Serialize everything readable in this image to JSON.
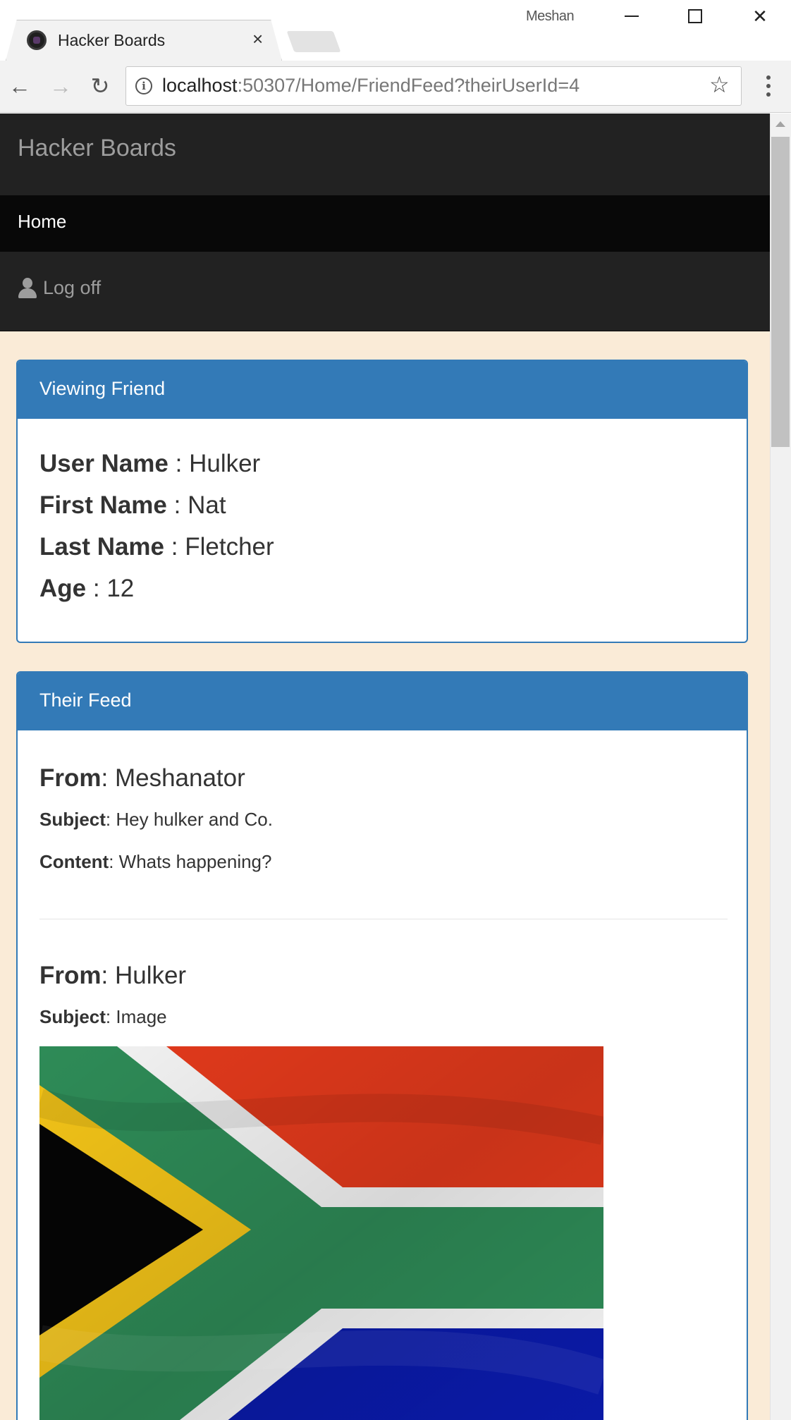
{
  "browser": {
    "tab_title": "Hacker Boards",
    "tab_close": "×",
    "profile_name": "Meshan",
    "url_host": "localhost",
    "url_rest": ":50307/Home/FriendFeed?theirUserId=4",
    "info_glyph": "i",
    "star_glyph": "☆",
    "back_glyph": "←",
    "forward_glyph": "→",
    "reload_glyph": "↻"
  },
  "navbar": {
    "brand": "Hacker Boards",
    "items": [
      {
        "label": "Home",
        "active": true
      }
    ],
    "logoff_label": "Log off"
  },
  "friend_panel": {
    "heading": "Viewing Friend",
    "fields": [
      {
        "label": "User Name",
        "separator": " : ",
        "value": "Hulker"
      },
      {
        "label": "First Name",
        "separator": " : ",
        "value": "Nat"
      },
      {
        "label": "Last Name",
        "separator": " : ",
        "value": "Fletcher"
      },
      {
        "label": "Age",
        "separator": " : ",
        "value": "12"
      }
    ]
  },
  "feed_panel": {
    "heading": "Their Feed",
    "posts": [
      {
        "from_label": "From",
        "from": "Meshanator",
        "subject_label": "Subject",
        "subject": "Hey hulker and Co.",
        "content_label": "Content",
        "content": "Whats happening?"
      },
      {
        "from_label": "From",
        "from": "Hulker",
        "subject_label": "Subject",
        "subject": "Image",
        "image": "south-africa-flag"
      }
    ]
  },
  "colors": {
    "navbar": "#222222",
    "navbar_active": "#080808",
    "page_background": "#faebd7",
    "panel_primary": "#337ab7",
    "text": "#333333"
  }
}
